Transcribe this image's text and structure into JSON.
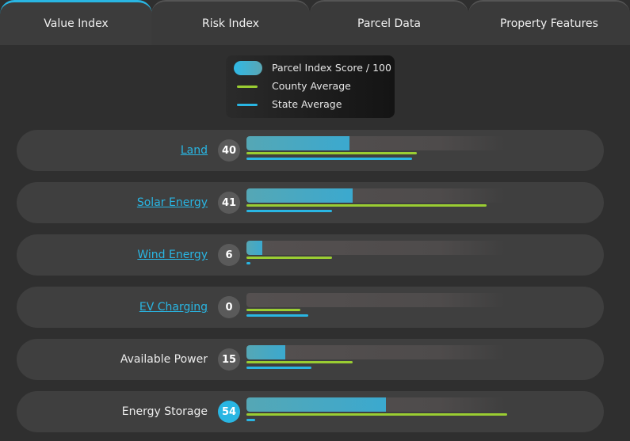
{
  "tabs": [
    {
      "label": "Value Index",
      "active": true
    },
    {
      "label": "Risk Index",
      "active": false
    },
    {
      "label": "Parcel Data",
      "active": false
    },
    {
      "label": "Property Features",
      "active": false
    }
  ],
  "legend": {
    "score": "Parcel Index Score / 100",
    "county": "County Average",
    "state": "State Average"
  },
  "colors": {
    "accent": "#29b6e3",
    "county": "#9acd32",
    "state": "#29b6e3"
  },
  "rows": [
    {
      "label": "Land",
      "link": true,
      "score": 40,
      "county_avg": 66,
      "state_avg": 64,
      "highlight": false
    },
    {
      "label": "Solar Energy",
      "link": true,
      "score": 41,
      "county_avg": 93,
      "state_avg": 33,
      "highlight": false
    },
    {
      "label": "Wind Energy",
      "link": true,
      "score": 6,
      "county_avg": 33,
      "state_avg": 1.5,
      "highlight": false
    },
    {
      "label": "EV Charging",
      "link": true,
      "score": 0,
      "county_avg": 21,
      "state_avg": 24,
      "highlight": false
    },
    {
      "label": "Available Power",
      "link": false,
      "score": 15,
      "county_avg": 41,
      "state_avg": 25,
      "highlight": false
    },
    {
      "label": "Energy Storage",
      "link": false,
      "score": 54,
      "county_avg": 101,
      "state_avg": 3.5,
      "highlight": true
    }
  ]
}
